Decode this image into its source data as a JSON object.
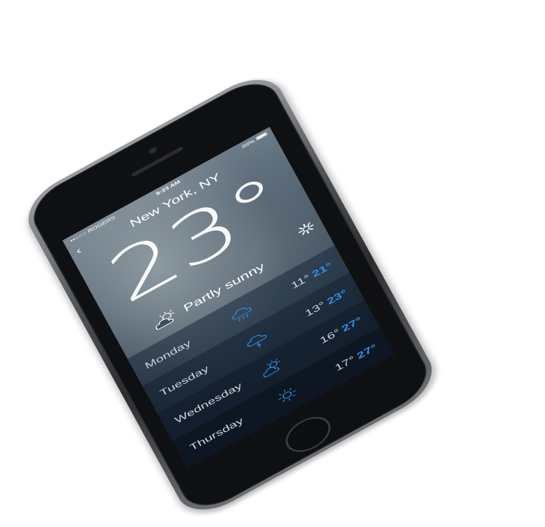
{
  "status_bar": {
    "carrier": "••○○○ ROGERS",
    "time": "9:23 AM",
    "battery": "99%"
  },
  "weather": {
    "city": "New York, NY",
    "temperature": "23°",
    "condition": "Partly sunny",
    "condition_icon": "partly-cloudy-icon"
  },
  "forecast": [
    {
      "day": "Monday",
      "icon": "rain-cloud-icon",
      "low": "11°",
      "high": "21°"
    },
    {
      "day": "Tuesday",
      "icon": "thunder-cloud-icon",
      "low": "13°",
      "high": "23°"
    },
    {
      "day": "Wednesday",
      "icon": "partly-cloudy-icon",
      "low": "16°",
      "high": "27°"
    },
    {
      "day": "Thursday",
      "icon": "sun-icon",
      "low": "17°",
      "high": "27°"
    }
  ],
  "colors": {
    "accent": "#2f8fe8",
    "text": "#ffffff",
    "muted_text": "#c9d3dc"
  }
}
